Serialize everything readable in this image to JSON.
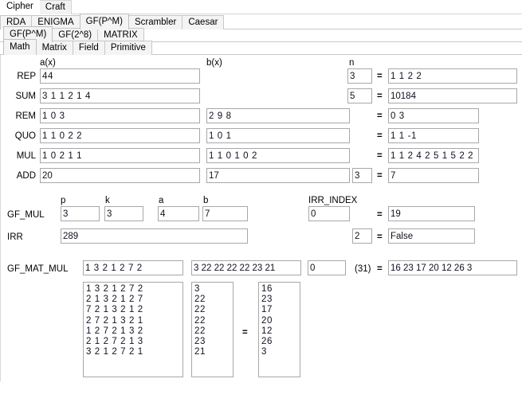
{
  "window": {
    "top_tabs": [
      {
        "label": "Cipher",
        "selected": true
      },
      {
        "label": "Craft",
        "selected": false
      }
    ],
    "level1_tabs": [
      {
        "label": "RDA",
        "selected": false
      },
      {
        "label": "ENIGMA",
        "selected": false
      },
      {
        "label": "GF(P^M)",
        "selected": true
      },
      {
        "label": "Scrambler",
        "selected": false
      },
      {
        "label": "Caesar",
        "selected": false
      }
    ],
    "level2_tabs": [
      {
        "label": "GF(P^M)",
        "selected": true
      },
      {
        "label": "GF(2^8)",
        "selected": false
      },
      {
        "label": "MATRIX",
        "selected": false
      }
    ],
    "level3_tabs": [
      {
        "label": "Math",
        "selected": true
      },
      {
        "label": "Matrix",
        "selected": false
      },
      {
        "label": "Field",
        "selected": false
      },
      {
        "label": "Primitive",
        "selected": false
      }
    ]
  },
  "headers": {
    "ax": "a(x)",
    "bx": "b(x)",
    "n": "n",
    "p": "p",
    "k": "k",
    "a": "a",
    "b": "b",
    "irr_index": "IRR_INDEX"
  },
  "equals": "=",
  "paren_note": "(31)",
  "rows": [
    {
      "label": "REP",
      "ax": "44",
      "bx": "",
      "n": "3",
      "result": "1 1 2 2"
    },
    {
      "label": "SUM",
      "ax": "3 1 1 2 1 4",
      "bx": "",
      "n": "5",
      "result": "10184"
    },
    {
      "label": "REM",
      "ax": "1 0 3",
      "bx": "2 9 8",
      "n": "",
      "result": "0 3"
    },
    {
      "label": "QUO",
      "ax": "1 1 0 2 2",
      "bx": "1 0 1",
      "n": "",
      "result": "1 1 -1"
    },
    {
      "label": "MUL",
      "ax": "1 0 2 1 1",
      "bx": "1 1 0 1 0 2",
      "n": "",
      "result": "1 1 2 4 2 5 1 5 2 2"
    },
    {
      "label": "ADD",
      "ax": "20",
      "bx": "17",
      "n": "3",
      "result": "7"
    }
  ],
  "gf_mul": {
    "label": "GF_MUL",
    "p": "3",
    "k": "3",
    "a": "4",
    "b": "7",
    "irr_index": "0",
    "result": "19"
  },
  "irr": {
    "label": "IRR",
    "value": "289",
    "index": "2",
    "result": "False"
  },
  "gf_mat_mul": {
    "label": "GF_MAT_MUL",
    "matrix_inline": "1 3 2 1 2 7 2",
    "vector_inline": "3 22 22 22 22 23 21",
    "index": "0",
    "note": "(31)",
    "result": "16 23 17 20 12 26 3"
  },
  "matrix_area": {
    "matrix": "1 3 2 1 2 7 2\n2 1 3 2 1 2 7\n7 2 1 3 2 1 2\n2 7 2 1 3 2 1\n1 2 7 2 1 3 2\n2 1 2 7 2 1 3\n3 2 1 2 7 2 1",
    "vector": "3\n22\n22\n22\n22\n23\n21",
    "result": "16\n23\n17\n20\n12\n26\n3",
    "equals": "="
  }
}
